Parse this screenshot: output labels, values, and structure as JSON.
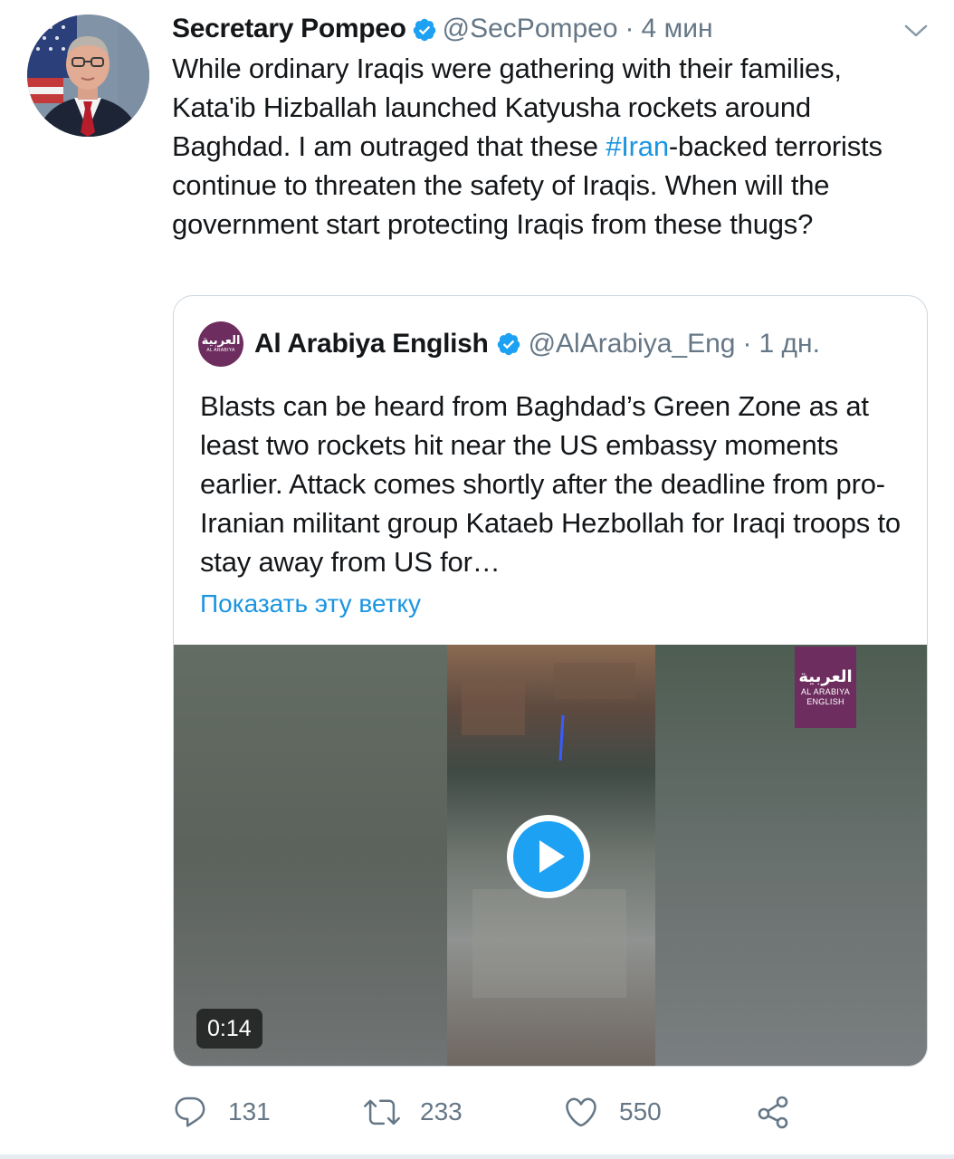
{
  "tweet": {
    "author_name": "Secretary Pompeo",
    "handle": "@SecPompeo",
    "separator": "·",
    "time": "4 мин",
    "text_before": "While ordinary Iraqis were gathering with their families, Kata'ib Hizballah launched Katyusha rockets around Baghdad. I am outraged that these ",
    "hashtag": "#Iran",
    "text_after": "-backed terrorists continue to threaten the safety of Iraqis. When will the government start protecting Iraqis from these thugs?"
  },
  "quoted": {
    "avatar_ar": "العربية",
    "avatar_en": "AL ARABIYA",
    "author_name": "Al Arabiya English",
    "handle": "@AlArabiya_Eng",
    "separator": "·",
    "time": "1 дн.",
    "text": "Blasts can be heard from Baghdad’s Green Zone as at least two rockets hit near the US embassy moments earlier. Attack comes shortly after the deadline from pro-Iranian militant group Kataeb Hezbollah for Iraqi troops to stay away from US for…",
    "show_thread": "Показать эту ветку",
    "video": {
      "logo_ar": "العربية",
      "logo_en_1": "AL ARABIYA",
      "logo_en_2": "ENGLISH",
      "duration": "0:14"
    }
  },
  "actions": {
    "replies": "131",
    "retweets": "233",
    "likes": "550"
  },
  "icons": {
    "verified": "verified-badge-icon",
    "caret": "chevron-down-icon",
    "reply": "reply-icon",
    "retweet": "retweet-icon",
    "like": "heart-icon",
    "share": "share-icon",
    "play": "play-icon"
  },
  "colors": {
    "link": "#1b95e0",
    "secondary_text": "#657786",
    "primary_text": "#14171a",
    "border": "#ccd6dd",
    "brand_purple": "#6d2d5f"
  }
}
